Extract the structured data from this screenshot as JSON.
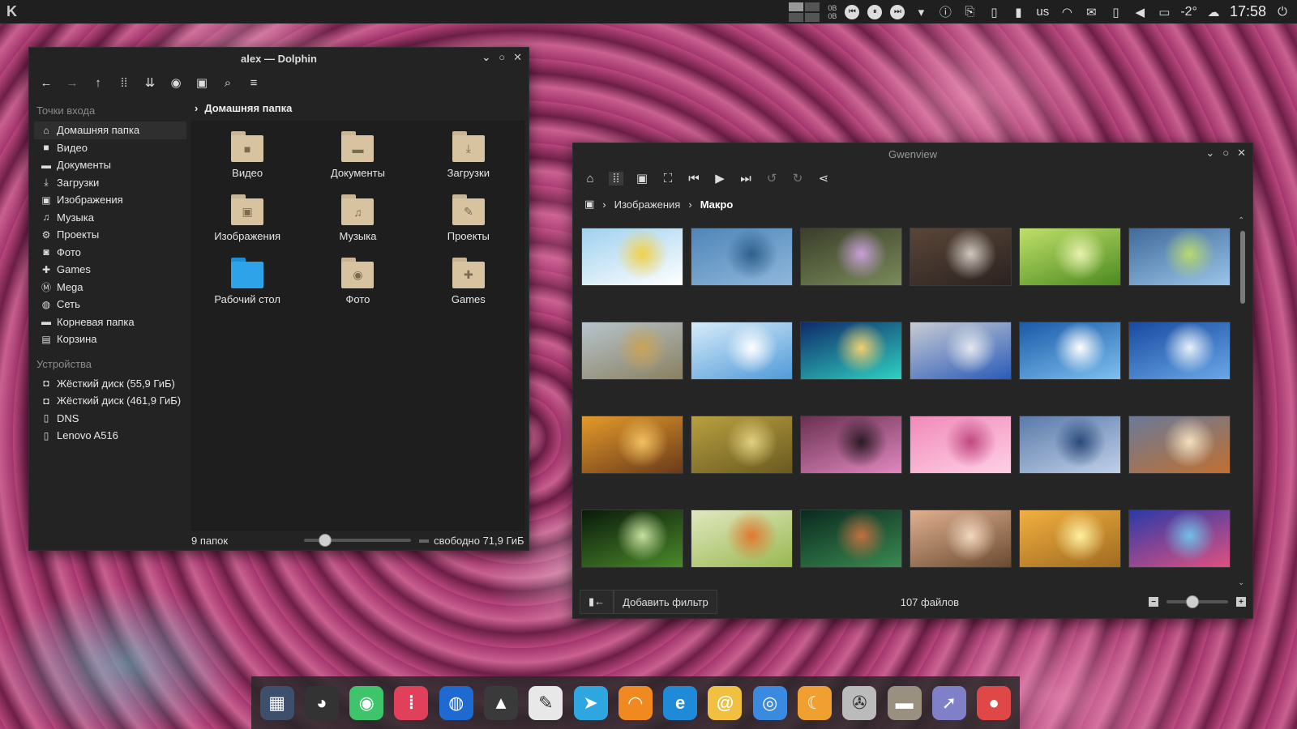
{
  "top_panel": {
    "kde_logo": "K",
    "net_up": "0B",
    "net_down": "0B",
    "keyboard_layout": "us",
    "temperature": "-2°",
    "clock": "17:58",
    "icons": [
      "pager-icon",
      "media-prev-icon",
      "media-pause-icon",
      "media-next-icon",
      "dropdown-icon",
      "notification-icon",
      "clipboard-icon",
      "storage-icon",
      "phone-icon",
      "rss-icon",
      "mail-icon",
      "phone-connect-icon",
      "volume-icon",
      "display-icon",
      "weather-icon",
      "power-icon"
    ]
  },
  "dolphin": {
    "title": "alex — Dolphin",
    "places_title": "Точки входа",
    "places": [
      {
        "label": "Домашняя папка",
        "icon": "home-icon",
        "active": true
      },
      {
        "label": "Видео",
        "icon": "video-icon"
      },
      {
        "label": "Документы",
        "icon": "document-icon"
      },
      {
        "label": "Загрузки",
        "icon": "download-icon"
      },
      {
        "label": "Изображения",
        "icon": "image-icon"
      },
      {
        "label": "Музыка",
        "icon": "music-icon"
      },
      {
        "label": "Проекты",
        "icon": "gear-icon"
      },
      {
        "label": "Фото",
        "icon": "camera-icon"
      },
      {
        "label": "Games",
        "icon": "gamepad-icon"
      },
      {
        "label": "Mega",
        "icon": "mega-icon"
      },
      {
        "label": "Сеть",
        "icon": "network-icon"
      },
      {
        "label": "Корневая папка",
        "icon": "folder-icon"
      },
      {
        "label": "Корзина",
        "icon": "trash-icon"
      }
    ],
    "devices_title": "Устройства",
    "devices": [
      {
        "label": "Жёсткий диск (55,9 ГиБ)",
        "icon": "disk-icon"
      },
      {
        "label": "Жёсткий диск (461,9 ГиБ)",
        "icon": "disk-icon"
      },
      {
        "label": "DNS",
        "icon": "phone-icon"
      },
      {
        "label": "Lenovo A516",
        "icon": "phone-icon"
      }
    ],
    "breadcrumb": "Домашняя папка",
    "folders": [
      {
        "label": "Видео",
        "glyph": "■"
      },
      {
        "label": "Документы",
        "glyph": "▬"
      },
      {
        "label": "Загрузки",
        "glyph": "⤓"
      },
      {
        "label": "Изображения",
        "glyph": "▣"
      },
      {
        "label": "Музыка",
        "glyph": "♫"
      },
      {
        "label": "Проекты",
        "glyph": "✎"
      },
      {
        "label": "Рабочий стол",
        "glyph": "",
        "desktop": true
      },
      {
        "label": "Фото",
        "glyph": "◉"
      },
      {
        "label": "Games",
        "glyph": "✚"
      }
    ],
    "status_count": "9 папок",
    "zoom_level": 0.2,
    "free_space": "свободно 71,9 ГиБ"
  },
  "gwenview": {
    "title": "Gwenview",
    "breadcrumb_parent": "Изображения",
    "breadcrumb_current": "Макро",
    "add_filter": "Добавить фильтр",
    "file_count": "107 файлов",
    "zoom_level": 0.42,
    "thumbnails": [
      {
        "name": "daisies",
        "colors": [
          "#9fd1ef",
          "#ffffff",
          "#f2d14a"
        ]
      },
      {
        "name": "water-hearts",
        "colors": [
          "#4f86b8",
          "#8fb7dc",
          "#2f5f8c"
        ]
      },
      {
        "name": "bokeh-flowers",
        "colors": [
          "#3a3f2a",
          "#7a8a5a",
          "#c8a0d8"
        ]
      },
      {
        "name": "wood-drop",
        "colors": [
          "#5a4638",
          "#2b2220",
          "#d0c8c0"
        ]
      },
      {
        "name": "green-leaves",
        "colors": [
          "#bfe06a",
          "#4c8a20",
          "#e8f2b0"
        ]
      },
      {
        "name": "bud-blue",
        "colors": [
          "#3f6a9a",
          "#9ac4e8",
          "#b8d870"
        ]
      },
      {
        "name": "field-fog",
        "colors": [
          "#b7c4cc",
          "#8a8060",
          "#c9a458"
        ]
      },
      {
        "name": "frost-flower",
        "colors": [
          "#d7ecfa",
          "#4f9ad8",
          "#ffffff"
        ]
      },
      {
        "name": "hand-heart",
        "colors": [
          "#0f2a6a",
          "#2fd1c0",
          "#f2d070"
        ]
      },
      {
        "name": "snowflake-blue",
        "colors": [
          "#c8ccd4",
          "#2a5ab8",
          "#e4e8ee"
        ]
      },
      {
        "name": "snowflake-sun",
        "colors": [
          "#1a5aa8",
          "#7ec0f0",
          "#ffffff"
        ]
      },
      {
        "name": "snowflake-field",
        "colors": [
          "#184aa0",
          "#6aa8e8",
          "#eaf2fa"
        ]
      },
      {
        "name": "teddy-bear",
        "colors": [
          "#e49a2a",
          "#6a3a1a",
          "#f2c060"
        ]
      },
      {
        "name": "willow",
        "colors": [
          "#b8a040",
          "#6a5a20",
          "#e0d080"
        ]
      },
      {
        "name": "orchid",
        "colors": [
          "#6a3050",
          "#e088c0",
          "#2a1a24"
        ]
      },
      {
        "name": "cherry-blossom",
        "colors": [
          "#f08ab8",
          "#ffd0e6",
          "#c04880"
        ]
      },
      {
        "name": "blue-branch",
        "colors": [
          "#5a7aaa",
          "#c0d0e8",
          "#2a4a7a"
        ]
      },
      {
        "name": "autumn-branch",
        "colors": [
          "#6a7a9a",
          "#c07030",
          "#f2e0c0"
        ]
      },
      {
        "name": "grass-dew",
        "colors": [
          "#0a1a0a",
          "#4a8a2a",
          "#c8e0a0"
        ]
      },
      {
        "name": "butterfly-white",
        "colors": [
          "#e0e8c0",
          "#9ab850",
          "#e07a30"
        ]
      },
      {
        "name": "butterfly-dark",
        "colors": [
          "#0a2a20",
          "#3a8a50",
          "#c07040"
        ]
      },
      {
        "name": "girl-face",
        "colors": [
          "#e0b090",
          "#6a4a30",
          "#f2d8c0"
        ]
      },
      {
        "name": "wheat",
        "colors": [
          "#f2b040",
          "#a06a20",
          "#fff0a0"
        ]
      },
      {
        "name": "blue-drops",
        "colors": [
          "#2a3aa8",
          "#e05080",
          "#70c0e8"
        ]
      }
    ]
  },
  "dock": [
    {
      "name": "panel-app",
      "bg": "#3d4f6a",
      "glyph": "▦"
    },
    {
      "name": "github-app",
      "bg": "#333333",
      "glyph": "◕"
    },
    {
      "name": "ghost-app",
      "bg": "#3ec46a",
      "glyph": "◉"
    },
    {
      "name": "mixer-app",
      "bg": "#e0405a",
      "glyph": "⦙"
    },
    {
      "name": "browser-sphere-app",
      "bg": "#1e6ad0",
      "glyph": "◍"
    },
    {
      "name": "inkscape-app",
      "bg": "#3a3a3a",
      "glyph": "▲"
    },
    {
      "name": "text-editor-app",
      "bg": "#e8e8e8",
      "glyph": "✎"
    },
    {
      "name": "telegram-app",
      "bg": "#2ea6e0",
      "glyph": "➤"
    },
    {
      "name": "rss-reader-app",
      "bg": "#f08a20",
      "glyph": "◠"
    },
    {
      "name": "edge-browser-app",
      "bg": "#1e8ad8",
      "glyph": "e"
    },
    {
      "name": "mail-app",
      "bg": "#f2c040",
      "glyph": "@"
    },
    {
      "name": "chromium-app",
      "bg": "#3a8ae0",
      "glyph": "◎"
    },
    {
      "name": "moon-app",
      "bg": "#f0a030",
      "glyph": "☾"
    },
    {
      "name": "video-player-app",
      "bg": "#bbbbbb",
      "glyph": "✇"
    },
    {
      "name": "file-manager-app",
      "bg": "#9a9080",
      "glyph": "▬"
    },
    {
      "name": "cursor-app",
      "bg": "#8080c8",
      "glyph": "➚"
    },
    {
      "name": "photo-app",
      "bg": "#e04848",
      "glyph": "●"
    }
  ]
}
